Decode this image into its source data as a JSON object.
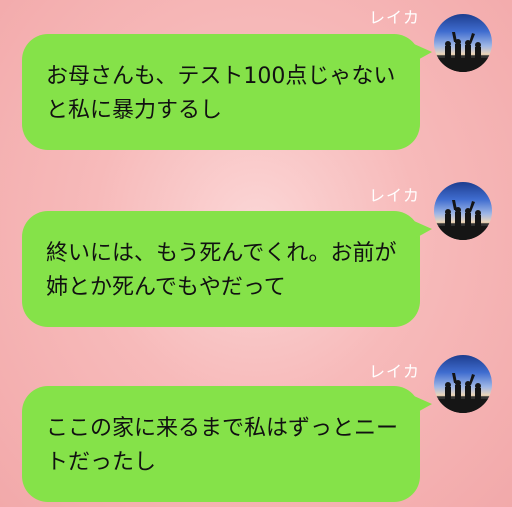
{
  "messages": [
    {
      "sender": "レイカ",
      "lines": [
        "お母さんも、テスト100点じゃない",
        "と私に暴力するし"
      ]
    },
    {
      "sender": "レイカ",
      "lines": [
        "終いには、もう死んでくれ。お前が",
        "姉とか死んでもやだって"
      ]
    },
    {
      "sender": "レイカ",
      "lines": [
        "ここの家に来るまで私はずっとニー",
        "トだったし"
      ]
    }
  ]
}
